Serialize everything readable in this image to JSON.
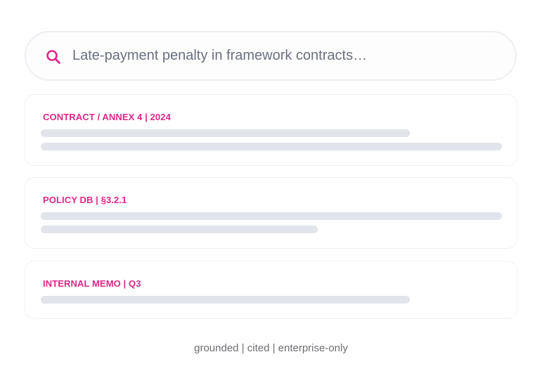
{
  "search": {
    "placeholder": "Late-payment penalty in framework contracts…",
    "icon": "search-icon",
    "accent_color": "#e0278a"
  },
  "results": [
    {
      "source": "CONTRACT / ANNEX 4 | 2024"
    },
    {
      "source": "POLICY DB | §3.2.1"
    },
    {
      "source": "INTERNAL MEMO | Q3"
    }
  ],
  "footer": {
    "tagline": "grounded | cited | enterprise-only"
  },
  "colors": {
    "accent": "#e0278a",
    "skeleton": "#e2e4eb",
    "card_border": "#eef0f3",
    "muted_text": "#6e6e73"
  }
}
